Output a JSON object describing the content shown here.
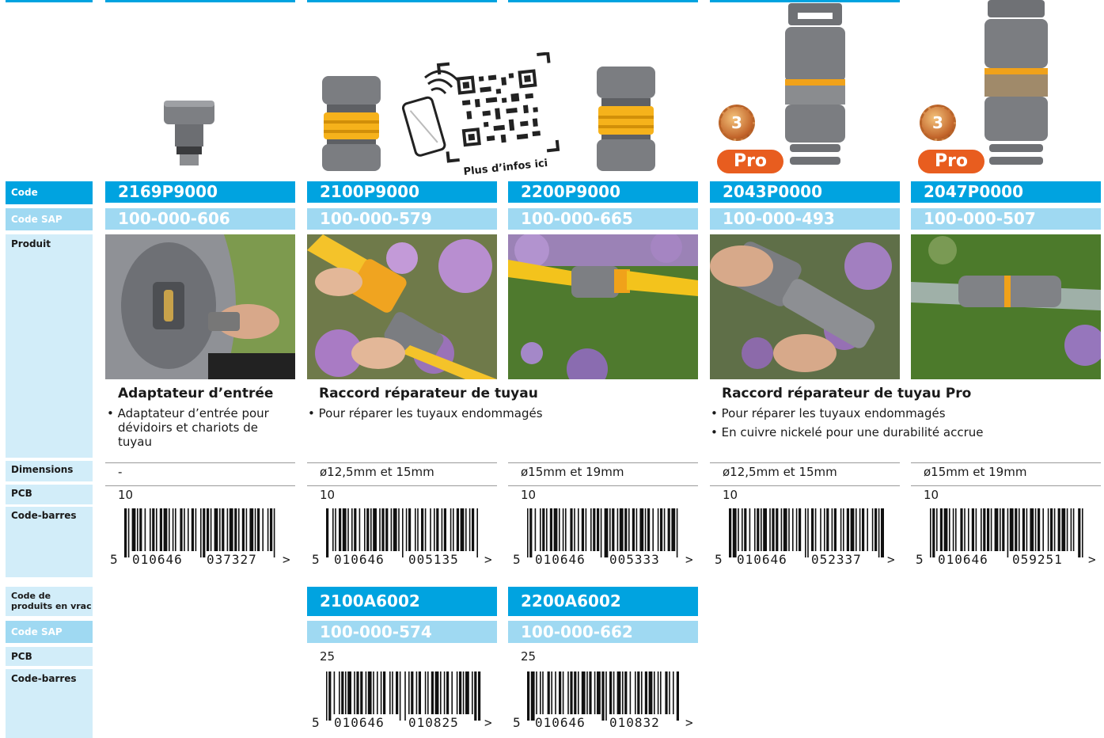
{
  "labels": {
    "code": "Code",
    "code_sap": "Code SAP",
    "produit": "Produit",
    "dimensions": "Dimensions",
    "pcb": "PCB",
    "code_barres": "Code-barres",
    "bulk_line1": "Code de",
    "bulk_line2": "produits en vrac",
    "bulk_code_sap": "Code SAP",
    "bulk_pcb": "PCB",
    "bulk_code_barres": "Code-barres"
  },
  "qr": {
    "caption": "Plus d’infos ici"
  },
  "badges": {
    "number": "3",
    "pro": "Pro"
  },
  "products": [
    {
      "code": "2169P9000",
      "sap": "100-000-606",
      "dimensions": "-",
      "pcb": "10",
      "barcode": {
        "first": "5",
        "g1": "010646",
        "g2": "037327",
        "arrow": ">"
      }
    },
    {
      "code": "2100P9000",
      "sap": "100-000-579",
      "dimensions": "ø12,5mm et 15mm",
      "pcb": "10",
      "barcode": {
        "first": "5",
        "g1": "010646",
        "g2": "005135",
        "arrow": ">"
      }
    },
    {
      "code": "2200P9000",
      "sap": "100-000-665",
      "dimensions": "ø15mm et 19mm",
      "pcb": "10",
      "barcode": {
        "first": "5",
        "g1": "010646",
        "g2": "005333",
        "arrow": ">"
      }
    },
    {
      "code": "2043P0000",
      "sap": "100-000-493",
      "dimensions": "ø12,5mm et 15mm",
      "pcb": "10",
      "barcode": {
        "first": "5",
        "g1": "010646",
        "g2": "052337",
        "arrow": ">"
      }
    },
    {
      "code": "2047P0000",
      "sap": "100-000-507",
      "dimensions": "ø15mm et 19mm",
      "pcb": "10",
      "barcode": {
        "first": "5",
        "g1": "010646",
        "g2": "059251",
        "arrow": ">"
      }
    }
  ],
  "groups": [
    {
      "title": "Adaptateur d’entrée",
      "bullets": [
        "Adaptateur d’entrée pour",
        "dévidoirs et chariots de",
        "tuyau"
      ]
    },
    {
      "title": "Raccord réparateur de tuyau",
      "bullets": [
        "Pour réparer les tuyaux endommagés"
      ]
    },
    {
      "title": "Raccord réparateur de tuyau Pro",
      "bullets": [
        "Pour réparer les tuyaux endommagés",
        "En cuivre nickelé pour une durabilité accrue"
      ]
    }
  ],
  "bulk": [
    {
      "code": "2100A6002",
      "sap": "100-000-574",
      "pcb": "25",
      "barcode": {
        "first": "5",
        "g1": "010646",
        "g2": "010825",
        "arrow": ">"
      }
    },
    {
      "code": "2200A6002",
      "sap": "100-000-662",
      "pcb": "25",
      "barcode": {
        "first": "5",
        "g1": "010646",
        "g2": "010832",
        "arrow": ">"
      }
    }
  ]
}
